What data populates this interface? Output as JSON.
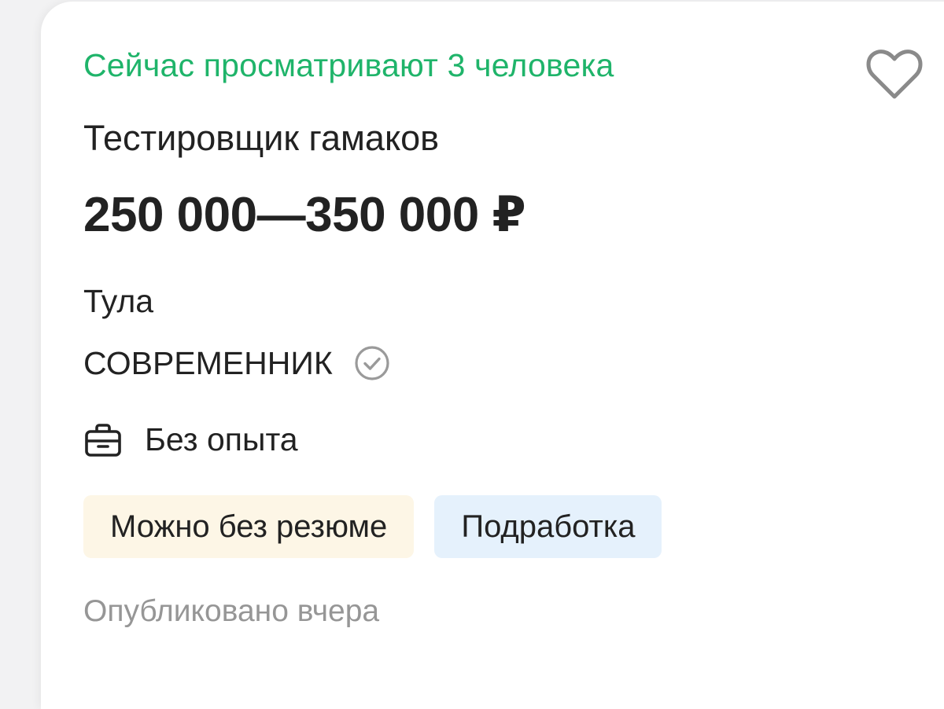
{
  "vacancy": {
    "viewers_text": "Сейчас просматривают 3 человека",
    "title": "Тестировщик гамаков",
    "salary": "250 000—350 000 ₽",
    "city": "Тула",
    "company": "СОВРЕМЕННИК",
    "experience": "Без опыта",
    "tags": [
      {
        "label": "Можно без резюме"
      },
      {
        "label": "Подработка"
      }
    ],
    "published": "Опубликовано вчера"
  },
  "icons": {
    "favorite": "heart-icon",
    "verified": "check-circle-icon",
    "experience": "briefcase-icon"
  },
  "colors": {
    "viewers": "#1fb46a",
    "text": "#222222",
    "muted": "#969696",
    "tag_yellow": "#fdf6e6",
    "tag_blue": "#e5f1fc"
  }
}
